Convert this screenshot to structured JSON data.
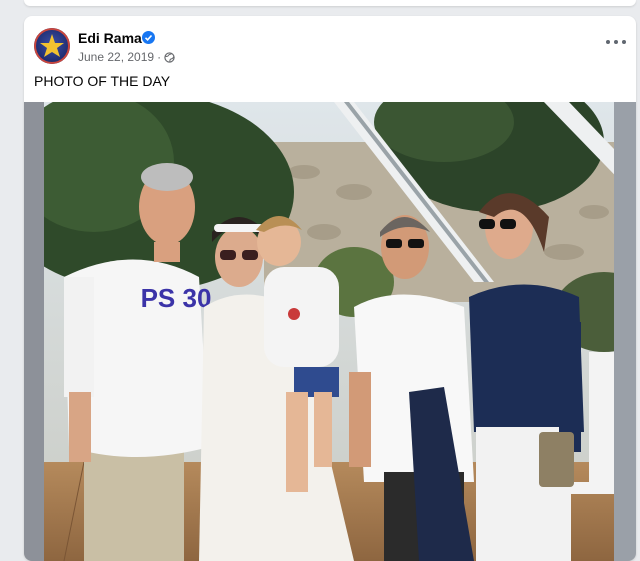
{
  "post": {
    "author_name": "Edi Rama",
    "date": "June 22, 2019",
    "separator": "·",
    "caption": "PHOTO OF THE DAY",
    "shirt_text": "PS 30"
  },
  "icons": {
    "verified": "verified-badge-icon",
    "privacy": "globe-icon",
    "more": "more-options-icon"
  },
  "colors": {
    "background": "#e9ebee",
    "card": "#ffffff",
    "meta_text": "#65676b",
    "verified_blue": "#1877f2"
  }
}
